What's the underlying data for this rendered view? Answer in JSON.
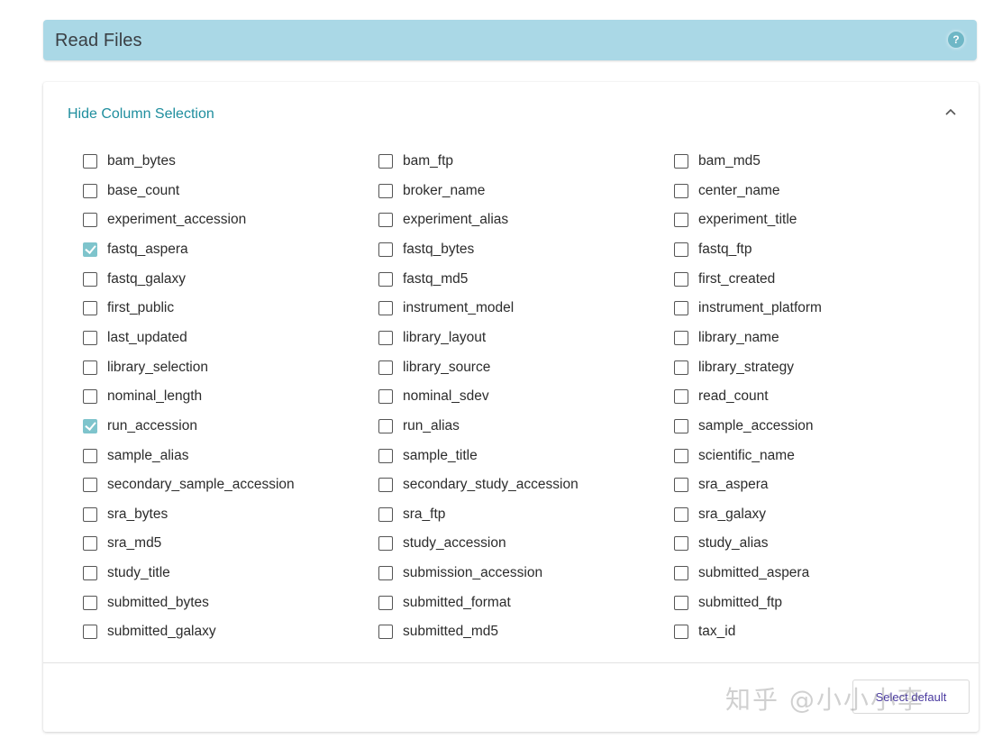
{
  "header": {
    "title": "Read Files",
    "help_icon": "?"
  },
  "panel": {
    "toggle_label": "Hide Column Selection",
    "select_default_label": "Select default"
  },
  "columns": [
    [
      {
        "label": "bam_bytes",
        "checked": false
      },
      {
        "label": "base_count",
        "checked": false
      },
      {
        "label": "experiment_accession",
        "checked": false
      },
      {
        "label": "fastq_aspera",
        "checked": true
      },
      {
        "label": "fastq_galaxy",
        "checked": false
      },
      {
        "label": "first_public",
        "checked": false
      },
      {
        "label": "last_updated",
        "checked": false
      },
      {
        "label": "library_selection",
        "checked": false
      },
      {
        "label": "nominal_length",
        "checked": false
      },
      {
        "label": "run_accession",
        "checked": true
      },
      {
        "label": "sample_alias",
        "checked": false
      },
      {
        "label": "secondary_sample_accession",
        "checked": false
      },
      {
        "label": "sra_bytes",
        "checked": false
      },
      {
        "label": "sra_md5",
        "checked": false
      },
      {
        "label": "study_title",
        "checked": false
      },
      {
        "label": "submitted_bytes",
        "checked": false
      },
      {
        "label": "submitted_galaxy",
        "checked": false
      }
    ],
    [
      {
        "label": "bam_ftp",
        "checked": false
      },
      {
        "label": "broker_name",
        "checked": false
      },
      {
        "label": "experiment_alias",
        "checked": false
      },
      {
        "label": "fastq_bytes",
        "checked": false
      },
      {
        "label": "fastq_md5",
        "checked": false
      },
      {
        "label": "instrument_model",
        "checked": false
      },
      {
        "label": "library_layout",
        "checked": false
      },
      {
        "label": "library_source",
        "checked": false
      },
      {
        "label": "nominal_sdev",
        "checked": false
      },
      {
        "label": "run_alias",
        "checked": false
      },
      {
        "label": "sample_title",
        "checked": false
      },
      {
        "label": "secondary_study_accession",
        "checked": false
      },
      {
        "label": "sra_ftp",
        "checked": false
      },
      {
        "label": "study_accession",
        "checked": false
      },
      {
        "label": "submission_accession",
        "checked": false
      },
      {
        "label": "submitted_format",
        "checked": false
      },
      {
        "label": "submitted_md5",
        "checked": false
      }
    ],
    [
      {
        "label": "bam_md5",
        "checked": false
      },
      {
        "label": "center_name",
        "checked": false
      },
      {
        "label": "experiment_title",
        "checked": false
      },
      {
        "label": "fastq_ftp",
        "checked": false
      },
      {
        "label": "first_created",
        "checked": false
      },
      {
        "label": "instrument_platform",
        "checked": false
      },
      {
        "label": "library_name",
        "checked": false
      },
      {
        "label": "library_strategy",
        "checked": false
      },
      {
        "label": "read_count",
        "checked": false
      },
      {
        "label": "sample_accession",
        "checked": false
      },
      {
        "label": "scientific_name",
        "checked": false
      },
      {
        "label": "sra_aspera",
        "checked": false
      },
      {
        "label": "sra_galaxy",
        "checked": false
      },
      {
        "label": "study_alias",
        "checked": false
      },
      {
        "label": "submitted_aspera",
        "checked": false
      },
      {
        "label": "submitted_ftp",
        "checked": false
      },
      {
        "label": "tax_id",
        "checked": false
      }
    ]
  ],
  "watermark": "知乎 @小小小李",
  "colors": {
    "header_bg": "#aad8e6",
    "link": "#1f8e9e",
    "checked": "#7ec4cc"
  }
}
